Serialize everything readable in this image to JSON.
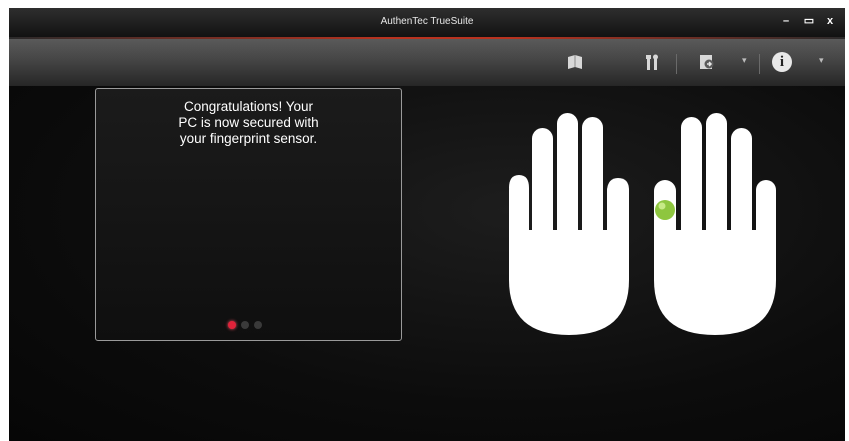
{
  "window": {
    "title": "AuthenTec TrueSuite",
    "controls": {
      "minimize": "–",
      "maximize": "▭",
      "close": "x"
    }
  },
  "toolbar": {
    "icons": [
      "book-icon",
      "tools-icon",
      "login-icon",
      "info-icon"
    ],
    "caret": "▾",
    "info_glyph": "i"
  },
  "message": {
    "line1": "Congratulations! Your",
    "line2": "PC is now secured with",
    "line3": "your fingerprint sensor."
  },
  "pager": {
    "total": 3,
    "active": 1
  },
  "fingerprint": {
    "enrolled_finger": "right-index",
    "marker_color": "#8ec63f"
  },
  "colors": {
    "accent": "#b8321f",
    "active_dot": "#e0233a",
    "hand": "#ffffff"
  }
}
